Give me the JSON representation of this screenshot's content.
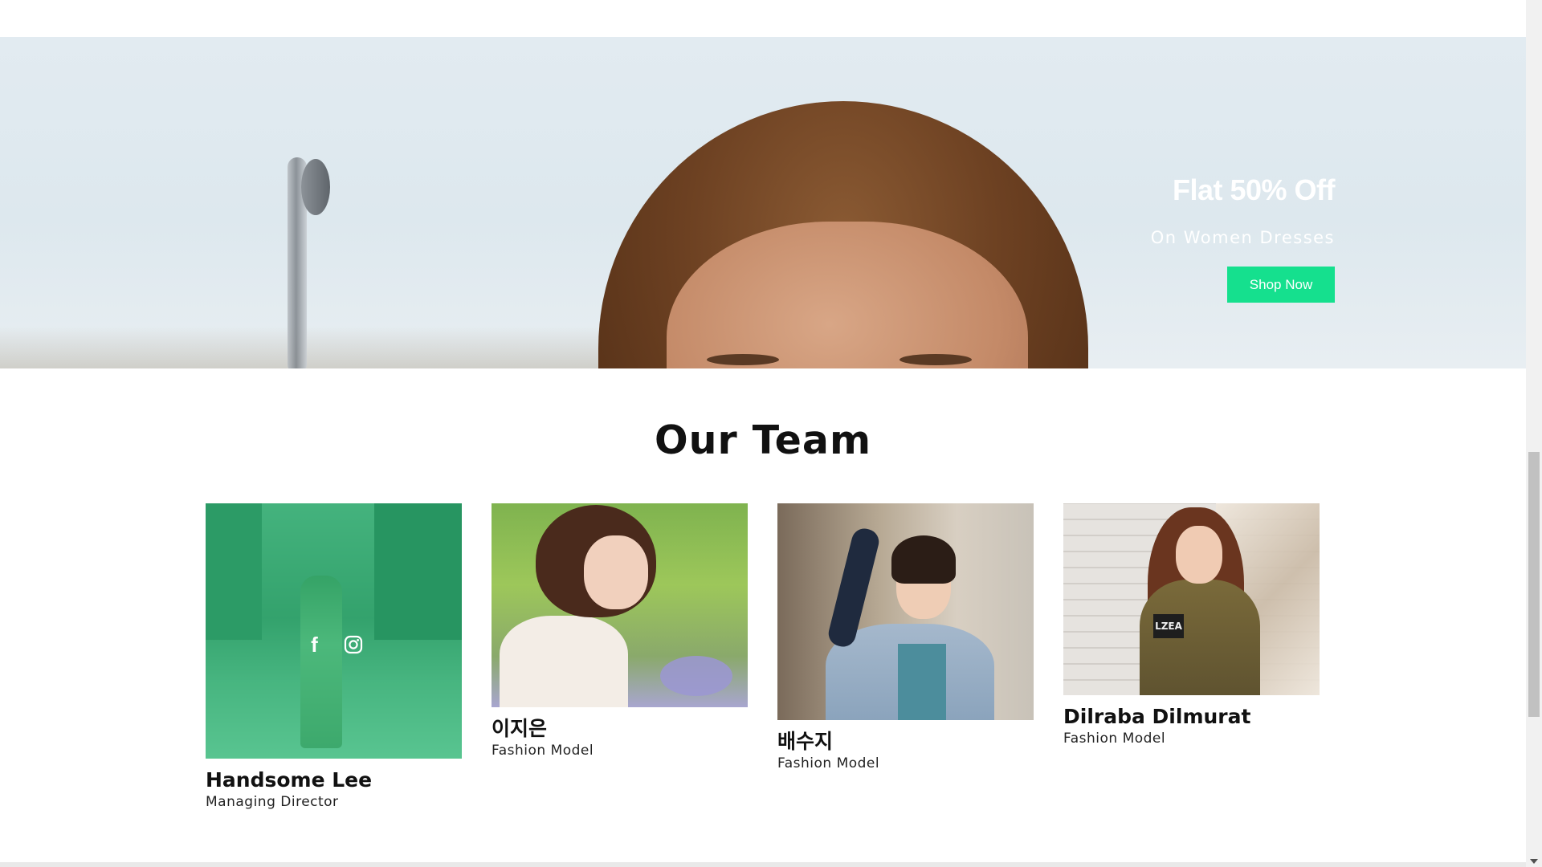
{
  "hero": {
    "title": "Flat 50% Off",
    "subtitle": "On Women Dresses",
    "button_label": "Shop Now",
    "accent_color": "#15e08e"
  },
  "team": {
    "heading": "Our Team",
    "members": [
      {
        "name": "Handsome Lee",
        "role": "Managing Director",
        "social_icons": [
          "facebook-icon",
          "instagram-icon"
        ]
      },
      {
        "name": "이지은",
        "role": "Fashion Model"
      },
      {
        "name": "배수지",
        "role": "Fashion Model"
      },
      {
        "name": "Dilraba Dilmurat",
        "role": "Fashion Model"
      }
    ]
  },
  "photo_patch_text": "LZEA",
  "colors": {
    "overlay": "#15d278",
    "text_dark": "#111111",
    "background": "#ffffff"
  }
}
